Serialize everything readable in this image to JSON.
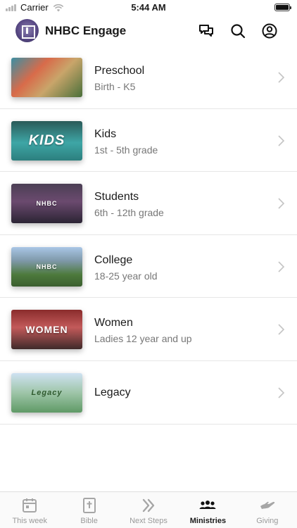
{
  "status_bar": {
    "carrier": "Carrier",
    "time": "5:44 AM"
  },
  "header": {
    "title": "NHBC Engage",
    "icons": [
      "chat-icon",
      "search-icon",
      "account-icon"
    ]
  },
  "ministries": [
    {
      "title": "Preschool",
      "subtitle": "Birth - K5",
      "thumb_text": ""
    },
    {
      "title": "Kids",
      "subtitle": "1st - 5th grade",
      "thumb_text": "KIDS"
    },
    {
      "title": "Students",
      "subtitle": "6th - 12th grade",
      "thumb_text": "NHBC"
    },
    {
      "title": "College",
      "subtitle": "18-25 year old",
      "thumb_text": "NHBC"
    },
    {
      "title": "Women",
      "subtitle": "Ladies 12 year and up",
      "thumb_text": "WOMEN"
    },
    {
      "title": "Legacy",
      "subtitle": "",
      "thumb_text": "Legacy"
    }
  ],
  "tabs": [
    {
      "label": "This week",
      "icon": "calendar-icon",
      "active": false
    },
    {
      "label": "Bible",
      "icon": "bible-icon",
      "active": false
    },
    {
      "label": "Next Steps",
      "icon": "double-chevron-icon",
      "active": false
    },
    {
      "label": "Ministries",
      "icon": "people-group-icon",
      "active": true
    },
    {
      "label": "Giving",
      "icon": "giving-hand-icon",
      "active": false
    }
  ]
}
